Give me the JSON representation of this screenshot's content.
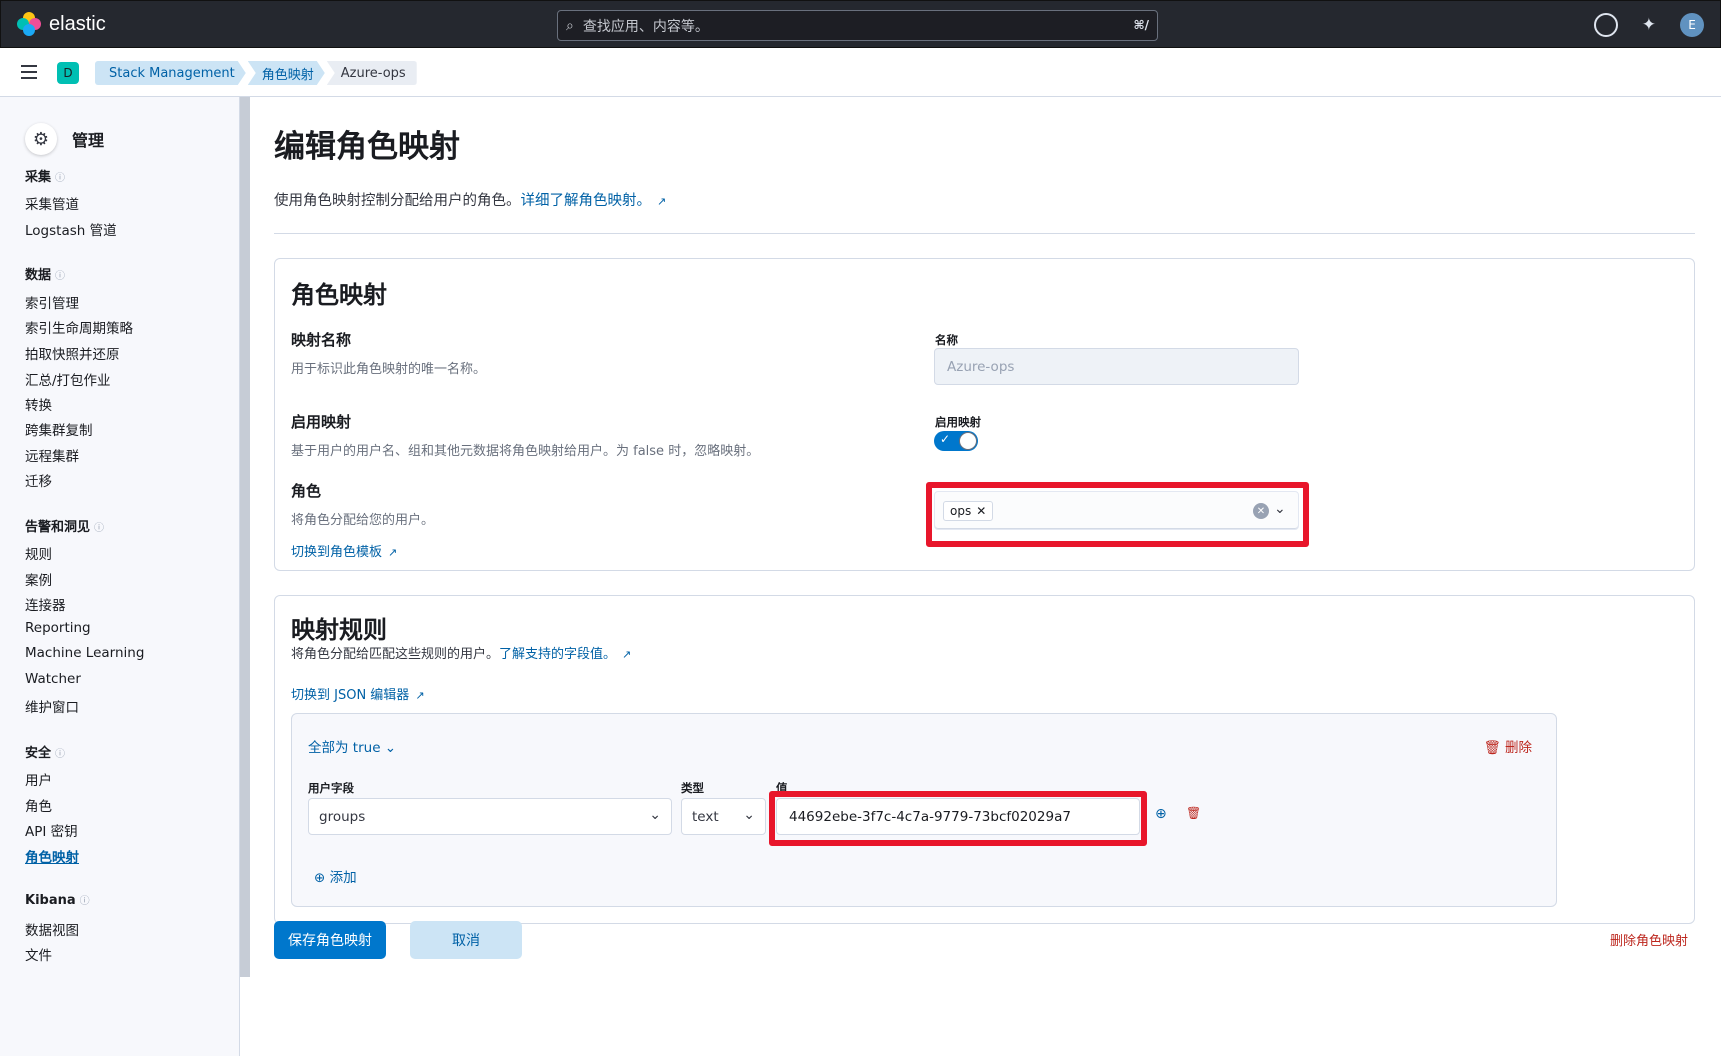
{
  "app": {
    "brand": "elastic",
    "space_initial": "D",
    "user_initial": "E"
  },
  "search": {
    "placeholder": "查找应用、内容等。",
    "shortcut": "⌘/"
  },
  "breadcrumbs": [
    "Stack Management",
    "角色映射",
    "Azure-ops"
  ],
  "sidebar": {
    "title": "管理",
    "groups": [
      {
        "label": "采集",
        "items": [
          "采集管道",
          "Logstash 管道"
        ]
      },
      {
        "label": "数据",
        "items": [
          "索引管理",
          "索引生命周期策略",
          "拍取快照并还原",
          "汇总/打包作业",
          "转换",
          "跨集群复制",
          "远程集群",
          "迁移"
        ]
      },
      {
        "label": "告警和洞见",
        "items": [
          "规则",
          "案例",
          "连接器",
          "Reporting",
          "Machine Learning",
          "Watcher",
          "维护窗口"
        ]
      },
      {
        "label": "安全",
        "items": [
          "用户",
          "角色",
          "API 密钥",
          "角色映射"
        ]
      },
      {
        "label": "Kibana",
        "items": [
          "数据视图",
          "文件"
        ]
      }
    ],
    "active_item": "角色映射"
  },
  "page": {
    "title": "编辑角色映射",
    "description": "使用角色映射控制分配给用户的角色。",
    "learn_more": "详细了解角色映射。"
  },
  "role_mapping": {
    "title": "角色映射",
    "name_section": {
      "title": "映射名称",
      "desc": "用于标识此角色映射的唯一名称。",
      "label": "名称",
      "value": "Azure-ops"
    },
    "enable_section": {
      "title": "启用映射",
      "desc": "基于用户的用户名、组和其他元数据将角色映射给用户。为 false 时，忽略映射。",
      "label": "启用映射",
      "enabled": true
    },
    "roles_section": {
      "title": "角色",
      "desc": "将角色分配给您的用户。",
      "switch_link": "切换到角色模板",
      "selected_roles": [
        "ops"
      ]
    }
  },
  "rules": {
    "title": "映射规则",
    "desc": "将角色分配给匹配这些规则的用户。",
    "learn_link": "了解支持的字段值。",
    "json_link": "切换到 JSON 编辑器",
    "group_label": "全部为 true",
    "delete_label": "删除",
    "columns": {
      "field": "用户字段",
      "type": "类型",
      "value": "值"
    },
    "row": {
      "field": "groups",
      "type": "text",
      "value": "44692ebe-3f7c-4c7a-9779-73bcf02029a7"
    },
    "add_label": "添加"
  },
  "actions": {
    "save": "保存角色映射",
    "cancel": "取消",
    "delete_mapping": "删除角色映射"
  },
  "colors": {
    "primary": "#0077cc",
    "highlight": "#e8162b",
    "danger": "#bd271e"
  }
}
